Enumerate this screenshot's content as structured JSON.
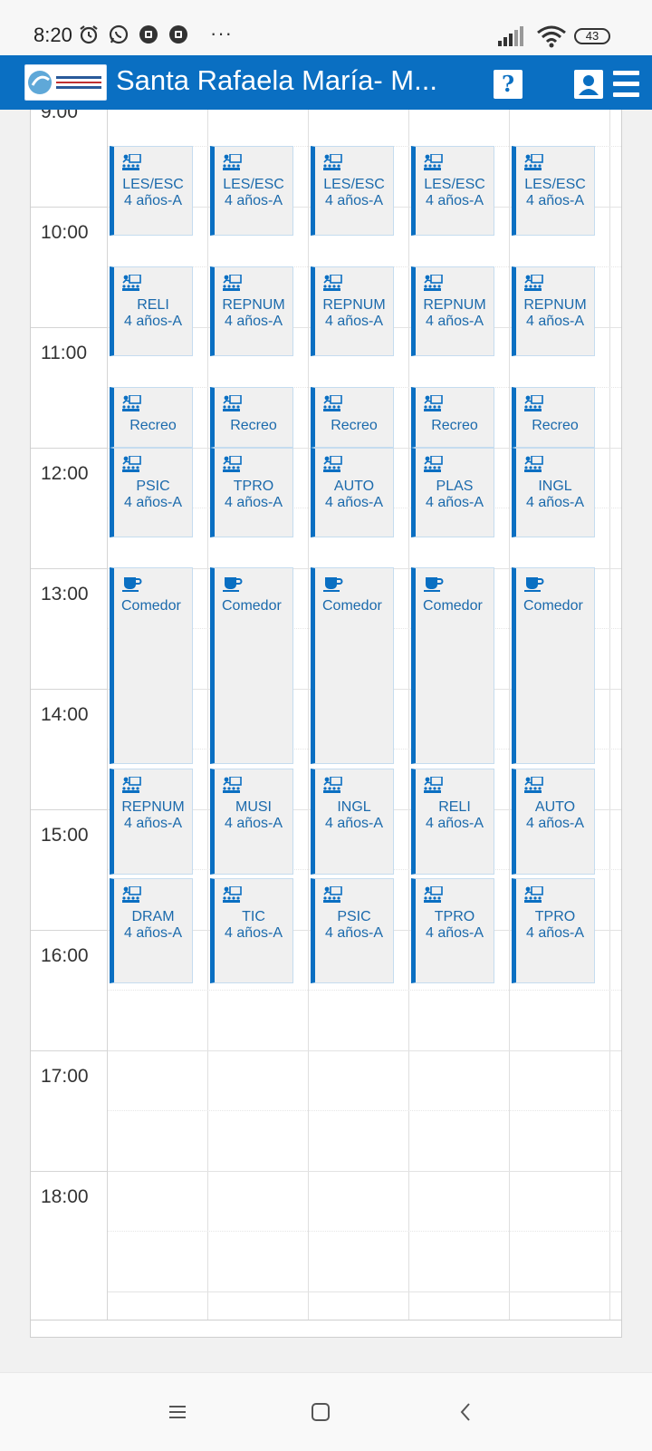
{
  "status_bar": {
    "time": "8:20",
    "battery": "43",
    "more": "···"
  },
  "header": {
    "title": "Santa Rafaela María- M...",
    "help_label": "?"
  },
  "hours": [
    "9:00",
    "10:00",
    "11:00",
    "12:00",
    "13:00",
    "14:00",
    "15:00",
    "16:00",
    "17:00",
    "18:00"
  ],
  "columns": [
    {
      "events": [
        {
          "kind": "class",
          "subject": "LES/ESC",
          "group": "4 años-A"
        },
        {
          "kind": "class",
          "subject": "RELI",
          "group": "4 años-A"
        },
        {
          "kind": "class",
          "subject": "Recreo",
          "group": ""
        },
        {
          "kind": "class",
          "subject": "PSIC",
          "group": "4 años-A"
        },
        {
          "kind": "meal",
          "subject": "Comedor",
          "group": ""
        },
        {
          "kind": "class",
          "subject": "REPNUM",
          "group": "4 años-A"
        },
        {
          "kind": "class",
          "subject": "DRAM",
          "group": "4 años-A"
        }
      ]
    },
    {
      "events": [
        {
          "kind": "class",
          "subject": "LES/ESC",
          "group": "4 años-A"
        },
        {
          "kind": "class",
          "subject": "REPNUM",
          "group": "4 años-A"
        },
        {
          "kind": "class",
          "subject": "Recreo",
          "group": ""
        },
        {
          "kind": "class",
          "subject": "TPRO",
          "group": "4 años-A"
        },
        {
          "kind": "meal",
          "subject": "Comedor",
          "group": ""
        },
        {
          "kind": "class",
          "subject": "MUSI",
          "group": "4 años-A"
        },
        {
          "kind": "class",
          "subject": "TIC",
          "group": "4 años-A"
        }
      ]
    },
    {
      "events": [
        {
          "kind": "class",
          "subject": "LES/ESC",
          "group": "4 años-A"
        },
        {
          "kind": "class",
          "subject": "REPNUM",
          "group": "4 años-A"
        },
        {
          "kind": "class",
          "subject": "Recreo",
          "group": ""
        },
        {
          "kind": "class",
          "subject": "AUTO",
          "group": "4 años-A"
        },
        {
          "kind": "meal",
          "subject": "Comedor",
          "group": ""
        },
        {
          "kind": "class",
          "subject": "INGL",
          "group": "4 años-A"
        },
        {
          "kind": "class",
          "subject": "PSIC",
          "group": "4 años-A"
        }
      ]
    },
    {
      "events": [
        {
          "kind": "class",
          "subject": "LES/ESC",
          "group": "4 años-A"
        },
        {
          "kind": "class",
          "subject": "REPNUM",
          "group": "4 años-A"
        },
        {
          "kind": "class",
          "subject": "Recreo",
          "group": ""
        },
        {
          "kind": "class",
          "subject": "PLAS",
          "group": "4 años-A"
        },
        {
          "kind": "meal",
          "subject": "Comedor",
          "group": ""
        },
        {
          "kind": "class",
          "subject": "RELI",
          "group": "4 años-A"
        },
        {
          "kind": "class",
          "subject": "TPRO",
          "group": "4 años-A"
        }
      ]
    },
    {
      "events": [
        {
          "kind": "class",
          "subject": "LES/ESC",
          "group": "4 años-A"
        },
        {
          "kind": "class",
          "subject": "REPNUM",
          "group": "4 años-A"
        },
        {
          "kind": "class",
          "subject": "Recreo",
          "group": ""
        },
        {
          "kind": "class",
          "subject": "INGL",
          "group": "4 años-A"
        },
        {
          "kind": "meal",
          "subject": "Comedor",
          "group": ""
        },
        {
          "kind": "class",
          "subject": "AUTO",
          "group": "4 años-A"
        },
        {
          "kind": "class",
          "subject": "TPRO",
          "group": "4 años-A"
        }
      ]
    }
  ],
  "colors": {
    "brand": "#0a6fc2",
    "event_bg": "#f0f0f0",
    "event_text": "#1b6aac"
  },
  "icons": {
    "class": "classroom-icon",
    "meal": "cup-icon",
    "help": "help-icon",
    "user": "user-icon",
    "menu": "menu-icon"
  }
}
